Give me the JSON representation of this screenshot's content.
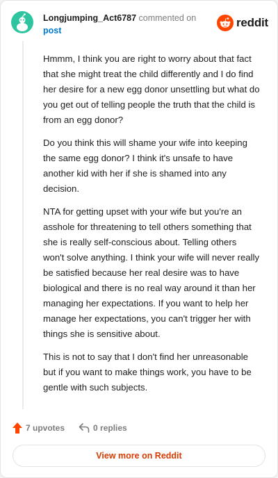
{
  "comment": {
    "author": "Longjumping_Act6787",
    "action_text": "commented on",
    "target_link": "post",
    "paragraphs": [
      "Hmmm, I think you are right to worry about that fact that she might treat the child differently and I do find her desire for a new egg donor unsettling but what do you get out of telling people the truth that the child is from an egg donor?",
      "Do you think this will shame your wife into keeping the same egg donor? I think it's unsafe to have another kid with her if she is shamed into any decision.",
      "NTA for getting upset with your wife but you're an asshole for threatening to tell others something that she is really self-conscious about. Telling others won't solve anything. I think your wife will never really be satisfied because her real desire was to have biological and there is no real way around it than her managing her expectations. If you want to help her manage her expectations, you can't trigger her with things she is sensitive about.",
      "This is not to say that I don't find her unreasonable but if you want to make things work, you have to be gentle with such subjects."
    ],
    "upvotes_label": "7 upvotes",
    "replies_label": "0 replies"
  },
  "brand": {
    "name": "reddit",
    "color": "#ff4500"
  },
  "footer": {
    "view_more_label": "View more on Reddit"
  },
  "colors": {
    "link": "#0079d3",
    "accent_orange": "#ff4500",
    "view_more_text": "#d93a00",
    "avatar_bg": "#2ec4a0"
  },
  "icons": {
    "avatar": "snoo-avatar-icon",
    "logo": "reddit-logo-icon",
    "upvote": "upvote-arrow-icon",
    "reply": "reply-arrow-icon"
  }
}
